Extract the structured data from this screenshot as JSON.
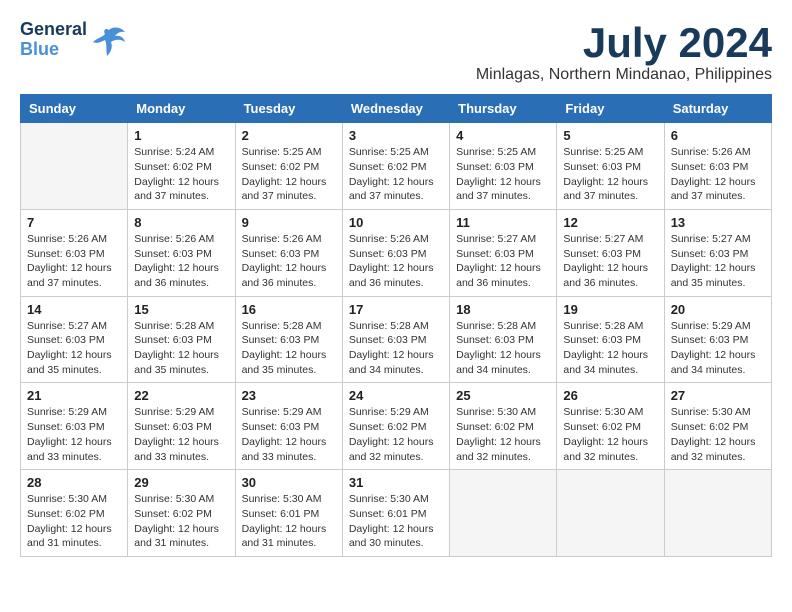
{
  "logo": {
    "line1": "General",
    "line2": "Blue"
  },
  "title": {
    "month_year": "July 2024",
    "location": "Minlagas, Northern Mindanao, Philippines"
  },
  "weekdays": [
    "Sunday",
    "Monday",
    "Tuesday",
    "Wednesday",
    "Thursday",
    "Friday",
    "Saturday"
  ],
  "weeks": [
    [
      {
        "day": "",
        "info": ""
      },
      {
        "day": "1",
        "info": "Sunrise: 5:24 AM\nSunset: 6:02 PM\nDaylight: 12 hours\nand 37 minutes."
      },
      {
        "day": "2",
        "info": "Sunrise: 5:25 AM\nSunset: 6:02 PM\nDaylight: 12 hours\nand 37 minutes."
      },
      {
        "day": "3",
        "info": "Sunrise: 5:25 AM\nSunset: 6:02 PM\nDaylight: 12 hours\nand 37 minutes."
      },
      {
        "day": "4",
        "info": "Sunrise: 5:25 AM\nSunset: 6:03 PM\nDaylight: 12 hours\nand 37 minutes."
      },
      {
        "day": "5",
        "info": "Sunrise: 5:25 AM\nSunset: 6:03 PM\nDaylight: 12 hours\nand 37 minutes."
      },
      {
        "day": "6",
        "info": "Sunrise: 5:26 AM\nSunset: 6:03 PM\nDaylight: 12 hours\nand 37 minutes."
      }
    ],
    [
      {
        "day": "7",
        "info": "Sunrise: 5:26 AM\nSunset: 6:03 PM\nDaylight: 12 hours\nand 37 minutes."
      },
      {
        "day": "8",
        "info": "Sunrise: 5:26 AM\nSunset: 6:03 PM\nDaylight: 12 hours\nand 36 minutes."
      },
      {
        "day": "9",
        "info": "Sunrise: 5:26 AM\nSunset: 6:03 PM\nDaylight: 12 hours\nand 36 minutes."
      },
      {
        "day": "10",
        "info": "Sunrise: 5:26 AM\nSunset: 6:03 PM\nDaylight: 12 hours\nand 36 minutes."
      },
      {
        "day": "11",
        "info": "Sunrise: 5:27 AM\nSunset: 6:03 PM\nDaylight: 12 hours\nand 36 minutes."
      },
      {
        "day": "12",
        "info": "Sunrise: 5:27 AM\nSunset: 6:03 PM\nDaylight: 12 hours\nand 36 minutes."
      },
      {
        "day": "13",
        "info": "Sunrise: 5:27 AM\nSunset: 6:03 PM\nDaylight: 12 hours\nand 35 minutes."
      }
    ],
    [
      {
        "day": "14",
        "info": "Sunrise: 5:27 AM\nSunset: 6:03 PM\nDaylight: 12 hours\nand 35 minutes."
      },
      {
        "day": "15",
        "info": "Sunrise: 5:28 AM\nSunset: 6:03 PM\nDaylight: 12 hours\nand 35 minutes."
      },
      {
        "day": "16",
        "info": "Sunrise: 5:28 AM\nSunset: 6:03 PM\nDaylight: 12 hours\nand 35 minutes."
      },
      {
        "day": "17",
        "info": "Sunrise: 5:28 AM\nSunset: 6:03 PM\nDaylight: 12 hours\nand 34 minutes."
      },
      {
        "day": "18",
        "info": "Sunrise: 5:28 AM\nSunset: 6:03 PM\nDaylight: 12 hours\nand 34 minutes."
      },
      {
        "day": "19",
        "info": "Sunrise: 5:28 AM\nSunset: 6:03 PM\nDaylight: 12 hours\nand 34 minutes."
      },
      {
        "day": "20",
        "info": "Sunrise: 5:29 AM\nSunset: 6:03 PM\nDaylight: 12 hours\nand 34 minutes."
      }
    ],
    [
      {
        "day": "21",
        "info": "Sunrise: 5:29 AM\nSunset: 6:03 PM\nDaylight: 12 hours\nand 33 minutes."
      },
      {
        "day": "22",
        "info": "Sunrise: 5:29 AM\nSunset: 6:03 PM\nDaylight: 12 hours\nand 33 minutes."
      },
      {
        "day": "23",
        "info": "Sunrise: 5:29 AM\nSunset: 6:03 PM\nDaylight: 12 hours\nand 33 minutes."
      },
      {
        "day": "24",
        "info": "Sunrise: 5:29 AM\nSunset: 6:02 PM\nDaylight: 12 hours\nand 32 minutes."
      },
      {
        "day": "25",
        "info": "Sunrise: 5:30 AM\nSunset: 6:02 PM\nDaylight: 12 hours\nand 32 minutes."
      },
      {
        "day": "26",
        "info": "Sunrise: 5:30 AM\nSunset: 6:02 PM\nDaylight: 12 hours\nand 32 minutes."
      },
      {
        "day": "27",
        "info": "Sunrise: 5:30 AM\nSunset: 6:02 PM\nDaylight: 12 hours\nand 32 minutes."
      }
    ],
    [
      {
        "day": "28",
        "info": "Sunrise: 5:30 AM\nSunset: 6:02 PM\nDaylight: 12 hours\nand 31 minutes."
      },
      {
        "day": "29",
        "info": "Sunrise: 5:30 AM\nSunset: 6:02 PM\nDaylight: 12 hours\nand 31 minutes."
      },
      {
        "day": "30",
        "info": "Sunrise: 5:30 AM\nSunset: 6:01 PM\nDaylight: 12 hours\nand 31 minutes."
      },
      {
        "day": "31",
        "info": "Sunrise: 5:30 AM\nSunset: 6:01 PM\nDaylight: 12 hours\nand 30 minutes."
      },
      {
        "day": "",
        "info": ""
      },
      {
        "day": "",
        "info": ""
      },
      {
        "day": "",
        "info": ""
      }
    ]
  ]
}
